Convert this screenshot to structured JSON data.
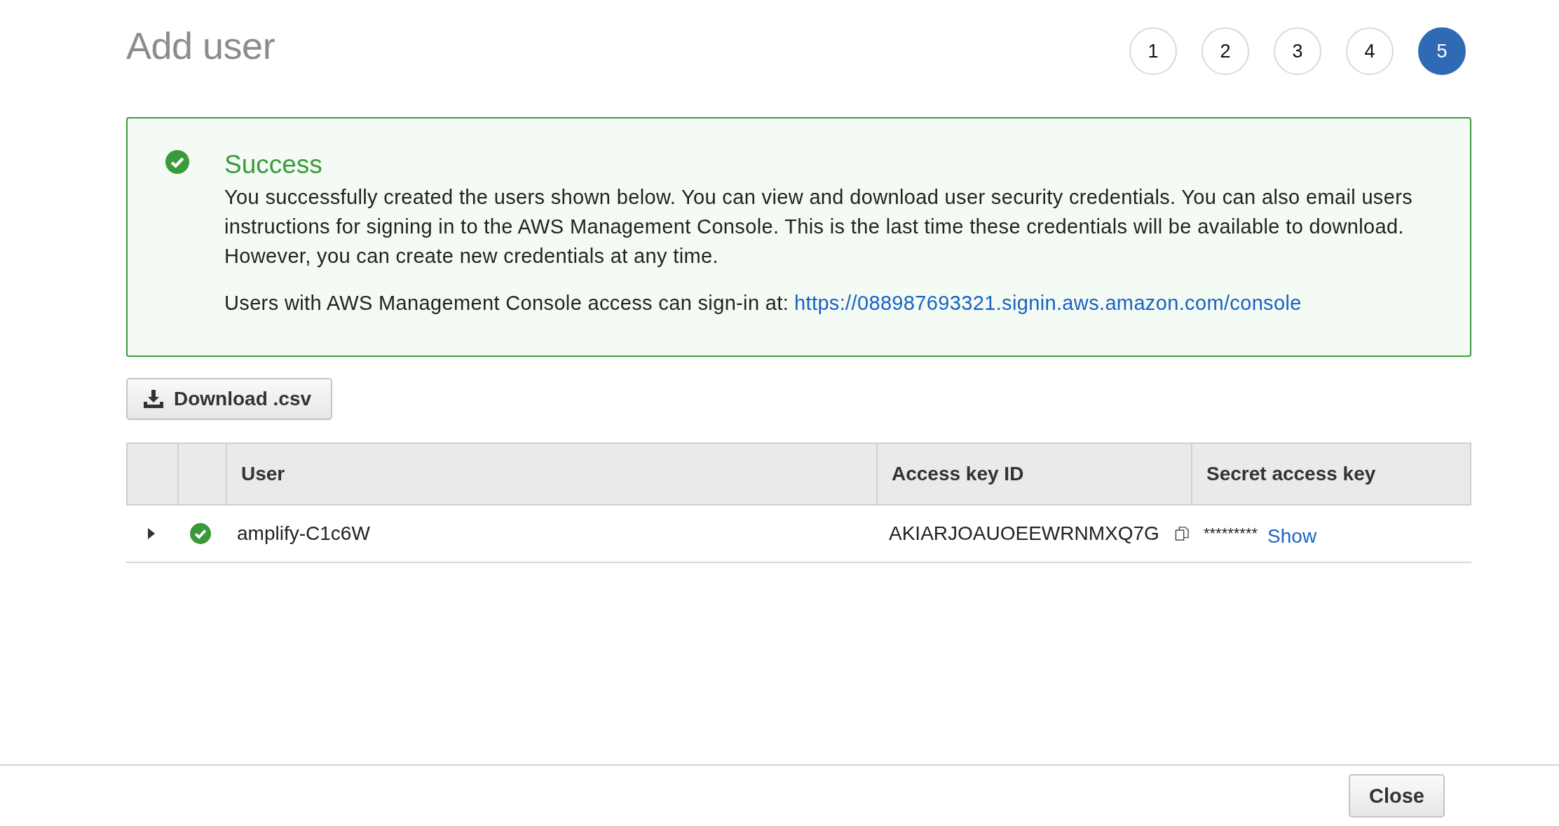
{
  "title": "Add user",
  "steps": [
    {
      "label": "1",
      "selected": false
    },
    {
      "label": "2",
      "selected": false
    },
    {
      "label": "3",
      "selected": false
    },
    {
      "label": "4",
      "selected": false
    },
    {
      "label": "5",
      "selected": true
    }
  ],
  "alert": {
    "kind": "success",
    "heading": "Success",
    "message": "You successfully created the users shown below. You can view and download user security credentials. You can also email users instructions for signing in to the AWS Management Console. This is the last time these credentials will be available to download. However, you can create new credentials at any time.",
    "signin_text": "Users with AWS Management Console access can sign-in at:",
    "signin_link": "https://088987693321.signin.aws.amazon.com/console"
  },
  "download_button": "Download .csv",
  "table": {
    "columns": [
      "User",
      "Access key ID",
      "Secret access key"
    ],
    "rows": [
      {
        "expanded": false,
        "created": true,
        "user": "amplify-C1c6W",
        "access_key_id": "AKIARJOAUOEEWRNMXQ7G",
        "secret_mask": "*********",
        "secret_action": "Show"
      }
    ]
  },
  "footer": {
    "close_button": "Close"
  }
}
